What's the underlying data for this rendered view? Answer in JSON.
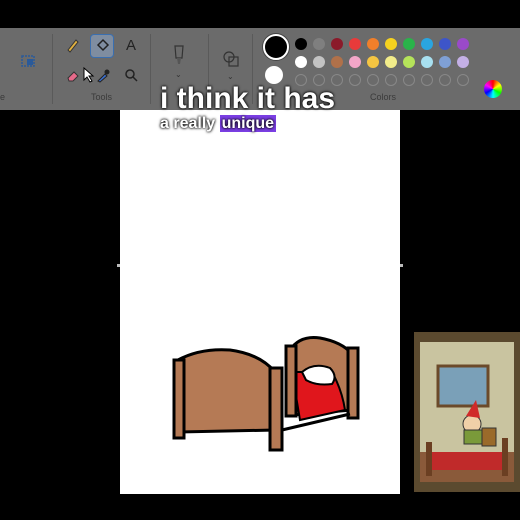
{
  "toolbar": {
    "tools_label": "Tools",
    "colors_label": "Colors",
    "left_label": "e"
  },
  "palette_row1": [
    "#000000",
    "#7f7f7f",
    "#8b1a2a",
    "#e83a3a",
    "#f07f2a",
    "#f5d21f",
    "#2ab34a",
    "#2aa5e0",
    "#3d55c9",
    "#9a4ac9"
  ],
  "palette_row2": [
    "#ffffff",
    "#c3c3c3",
    "#b0714a",
    "#f3a6c8",
    "#f5c542",
    "#f2ec8a",
    "#b5e35a",
    "#a8e0f0",
    "#7fa0d6",
    "#c4b0e6"
  ],
  "caption": {
    "line1": "i think it has",
    "line2_plain": "a really",
    "line2_highlight": "unique"
  },
  "colors": {
    "bed_wood": "#b57a55",
    "blanket": "#e0161c",
    "highlight": "#7b3fe4"
  }
}
